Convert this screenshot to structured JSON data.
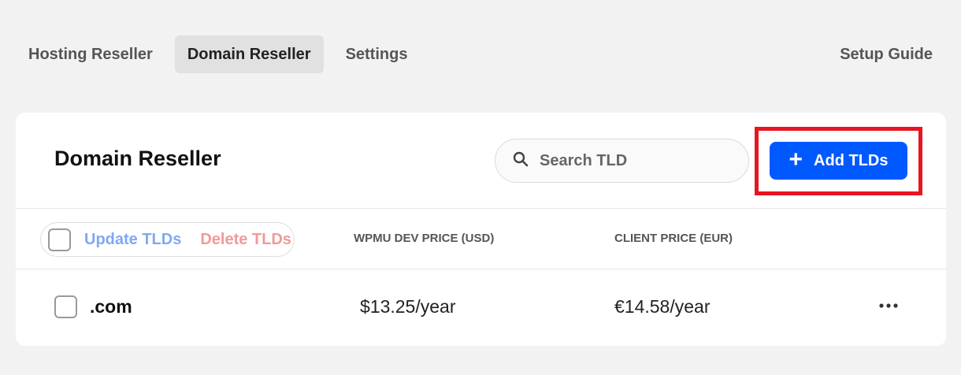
{
  "nav": {
    "tabs": [
      {
        "label": "Hosting Reseller",
        "active": false
      },
      {
        "label": "Domain Reseller",
        "active": true
      },
      {
        "label": "Settings",
        "active": false
      }
    ],
    "setup_guide": "Setup Guide"
  },
  "card": {
    "title": "Domain Reseller",
    "search_placeholder": "Search TLD",
    "add_button": "Add TLDs"
  },
  "table": {
    "bulk": {
      "update": "Update TLDs",
      "delete": "Delete TLDs"
    },
    "columns": [
      "WPMU DEV PRICE (USD)",
      "CLIENT PRICE (EUR)"
    ],
    "rows": [
      {
        "tld": ".com",
        "wpmu_price": "$13.25/year",
        "client_price": "€14.58/year"
      }
    ]
  },
  "colors": {
    "accent": "#0059ff",
    "highlight": "#e8141f",
    "update": "#7fa8f5",
    "delete": "#f09a9a"
  }
}
